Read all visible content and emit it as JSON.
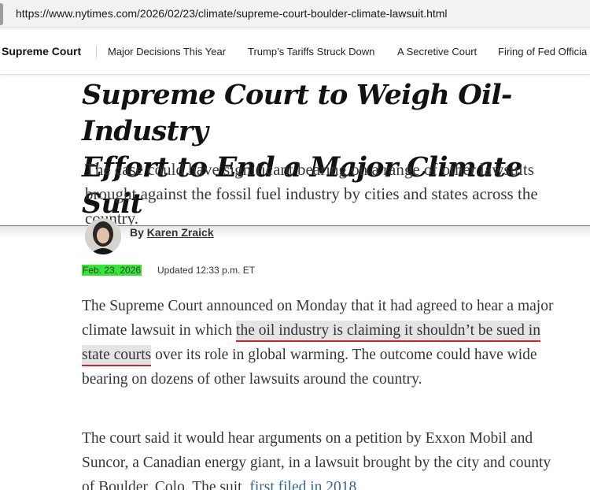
{
  "browser": {
    "url": "https://www.nytimes.com/2026/02/23/climate/supreme-court-boulder-climate-lawsuit.html"
  },
  "section_nav": {
    "brand": "Supreme Court",
    "links": [
      "Major Decisions This Year",
      "Trump’s Tariffs Struck Down",
      "A Secretive Court",
      "Firing of Fed Officia"
    ]
  },
  "article": {
    "headline_line1": "Supreme Court to Weigh Oil-Industry",
    "headline_line2": "Effort to End a Major Climate Suit",
    "summary": "The case could have significant bearing on a range of other lawsuits brought against the fossil fuel industry by cities and states across the country.",
    "byline_prefix": "By",
    "author": "Karen Zraick",
    "date": "Feb. 23, 2026",
    "updated": "Updated 12:33 p.m. ET",
    "para1_before": "The Supreme Court announced on Monday that it had agreed to hear a major climate lawsuit in which ",
    "para1_highlight": "the oil industry is claiming it shouldn’t be sued in state courts",
    "para1_after": " over its role in global warming. The outcome could have wide bearing on dozens of other lawsuits around the country.",
    "para2_before": "The court said it would hear arguments on a petition by Exxon Mobil and Suncor, a Canadian energy giant, in a lawsuit brought by the city and county of Boulder, Colo. The suit, ",
    "para2_link": "first filed in 2018"
  },
  "colors": {
    "date_highlight": "#35e735",
    "text_highlight": "#e4e4e4",
    "underline_red": "#c8262c",
    "link_blue": "#326891"
  }
}
